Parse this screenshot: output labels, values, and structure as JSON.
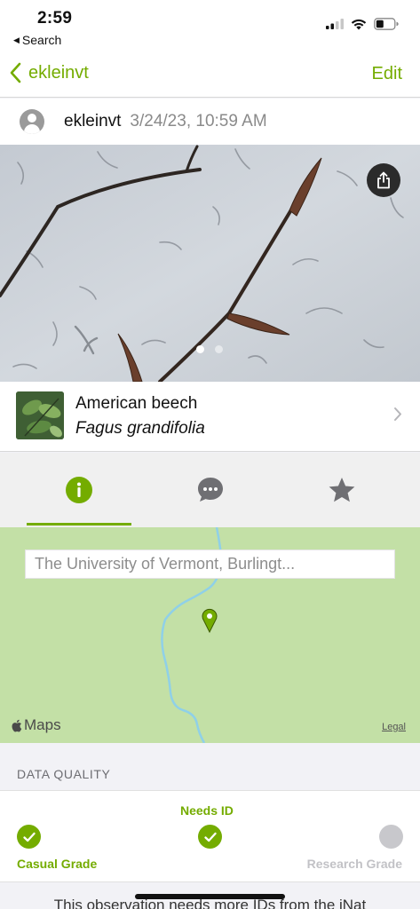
{
  "status_bar": {
    "time": "2:59",
    "back_app": "Search",
    "icons": [
      "signal-icon",
      "wifi-icon",
      "battery-icon"
    ]
  },
  "nav": {
    "back_label": "ekleinvt",
    "edit_label": "Edit"
  },
  "observer": {
    "username": "ekleinvt",
    "datetime": "3/24/23, 10:59 AM"
  },
  "photo": {
    "page_count": 2,
    "current_page": 1
  },
  "taxon": {
    "common_name": "American beech",
    "scientific_name": "Fagus grandifolia"
  },
  "tabs": [
    {
      "name": "info",
      "icon": "info-icon",
      "active": true
    },
    {
      "name": "activity",
      "icon": "chat-bubble-icon",
      "active": false
    },
    {
      "name": "favorites",
      "icon": "star-icon",
      "active": false
    }
  ],
  "map": {
    "location_label": "The University of Vermont, Burlingt...",
    "provider": "Maps",
    "legal": "Legal"
  },
  "data_quality": {
    "title": "DATA QUALITY",
    "needs_id": "Needs ID",
    "casual": "Casual Grade",
    "research": "Research Grade"
  },
  "footer": {
    "text": "This observation needs more IDs from the iNat"
  },
  "colors": {
    "accent": "#74ac00",
    "map_bg": "#c3e0a6",
    "river": "#8fd0e8"
  }
}
